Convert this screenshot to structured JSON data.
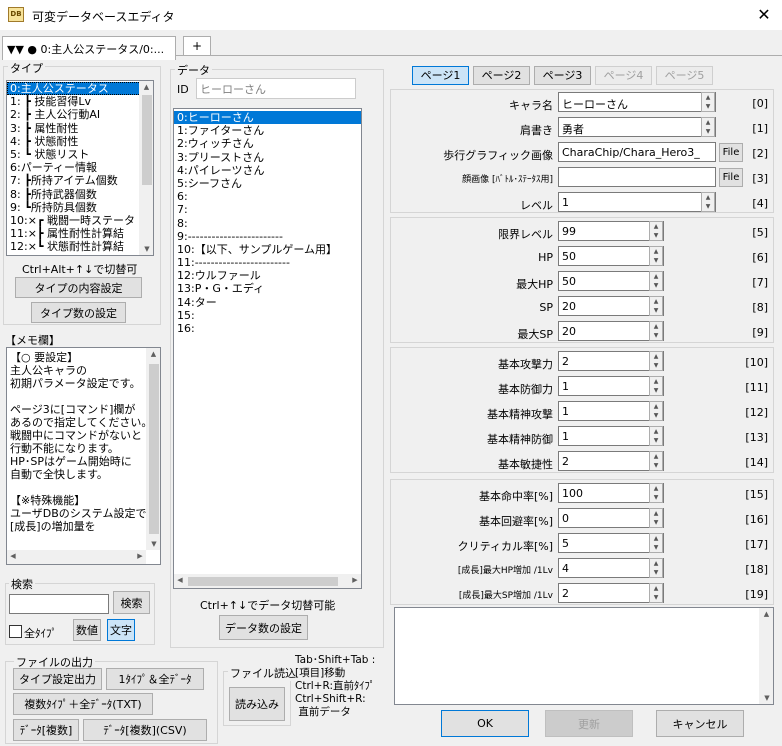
{
  "window": {
    "title": "可変データベースエディタ",
    "close": "✕",
    "app_icon": "DB"
  },
  "tabs": {
    "active": "▼▼ ● 0:主人公ステータス/0:...",
    "add": "+"
  },
  "type_panel": {
    "label": "タイプ",
    "items": [
      "0:主人公ステータス",
      "1: ┣ 技能習得Lv",
      "2: ┣ 主人公行動AI",
      "3: ┣ 属性耐性",
      "4: ┣ 状態耐性",
      "5: ┗ 状態リスト",
      "6:パーティー情報",
      "7: ┣所持アイテム個数",
      "8: ┣所持武器個数",
      "9: ┗所持防具個数",
      "10:×┏ 戦闘一時ステータ",
      "11:×┣ 属性耐性計算結",
      "12:×┗ 状態耐性計算結"
    ],
    "hint": "Ctrl+Alt+↑↓で切替可",
    "content_btn": "タイプの内容設定",
    "count_btn": "タイプ数の設定"
  },
  "memo": {
    "label": "【メモ欄】",
    "text": "【○ 要設定】\n主人公キャラの\n初期パラメータ設定です。\n\nページ3に[コマンド]欄が\nあるので指定してください。\n戦闘中にコマンドがないと\n行動不能になります。\nHP･SPはゲーム開始時に\n自動で全快します。\n\n【※特殊機能】\nユーザDBのシステム設定で\n[成長]の増加量を"
  },
  "search": {
    "label": "検索",
    "button": "検索",
    "all_types": "全ﾀｲﾌﾟ",
    "num_btn": "数値",
    "text_btn": "文字"
  },
  "file_out": {
    "label": "ファイルの出力",
    "type_out": "タイプ設定出力",
    "one_all": "1ﾀｲﾌﾟ＆全ﾃﾞｰﾀ",
    "multi_all": "複数ﾀｲﾌﾟ＋全ﾃﾞｰﾀ(TXT)",
    "data_multi": "ﾃﾞｰﾀ[複数]",
    "data_multi_csv": "ﾃﾞｰﾀ[複数](CSV)"
  },
  "file_in": {
    "label": "ファイル読込",
    "load": "読み込み"
  },
  "shortcut_help": "Tab･Shift+Tab :\n[項目]移動\nCtrl+R:直前ﾀｲﾌﾟ\nCtrl+Shift+R:\n 直前データ",
  "data_panel": {
    "label": "データ",
    "id_label": "ID",
    "id_value": "ヒーローさん",
    "items": [
      "0:ヒーローさん",
      "1:ファイターさん",
      "2:ウィッチさん",
      "3:プリーストさん",
      "4:パイレーツさん",
      "5:シーフさん",
      "6:",
      "7:",
      "8:",
      "9:------------------------",
      "10:【以下、サンプルゲーム用】",
      "11:------------------------",
      "12:ウルファール",
      "13:P・G・エディ",
      "14:ター",
      "15:",
      "16:"
    ],
    "hint": "Ctrl+↑↓でデータ切替可能",
    "count_btn": "データ数の設定"
  },
  "pages": [
    "ページ1",
    "ページ2",
    "ページ3",
    "ページ4",
    "ページ5"
  ],
  "fields_a": [
    {
      "label": "キャラ名",
      "value": "ヒーローさん",
      "idx": "[0]"
    },
    {
      "label": "肩書き",
      "value": "勇者",
      "idx": "[1]"
    },
    {
      "label": "歩行グラフィック画像",
      "value": "CharaChip/Chara_Hero3_",
      "idx": "[2]",
      "file": "File"
    },
    {
      "label": "顔画像 [ﾊﾞﾄﾙ･ｽﾃｰﾀｽ用]",
      "value": "",
      "idx": "[3]",
      "file": "File"
    },
    {
      "label": "レベル",
      "value": "1",
      "idx": "[4]"
    }
  ],
  "fields_b": [
    {
      "label": "限界レベル",
      "value": "99",
      "idx": "[5]"
    },
    {
      "label": "HP",
      "value": "50",
      "idx": "[6]"
    },
    {
      "label": "最大HP",
      "value": "50",
      "idx": "[7]"
    },
    {
      "label": "SP",
      "value": "20",
      "idx": "[8]"
    },
    {
      "label": "最大SP",
      "value": "20",
      "idx": "[9]"
    }
  ],
  "fields_c": [
    {
      "label": "基本攻撃力",
      "value": "2",
      "idx": "[10]"
    },
    {
      "label": "基本防御力",
      "value": "1",
      "idx": "[11]"
    },
    {
      "label": "基本精神攻撃",
      "value": "1",
      "idx": "[12]"
    },
    {
      "label": "基本精神防御",
      "value": "1",
      "idx": "[13]"
    },
    {
      "label": "基本敏捷性",
      "value": "2",
      "idx": "[14]"
    }
  ],
  "fields_d": [
    {
      "label": "基本命中率[%]",
      "value": "100",
      "idx": "[15]"
    },
    {
      "label": "基本回避率[%]",
      "value": "0",
      "idx": "[16]"
    },
    {
      "label": "クリティカル率[%]",
      "value": "5",
      "idx": "[17]"
    },
    {
      "label": "[成長]最大HP増加 /1Lv",
      "value": "4",
      "idx": "[18]"
    },
    {
      "label": "[成長]最大SP増加 /1Lv",
      "value": "2",
      "idx": "[19]"
    }
  ],
  "actions": {
    "ok": "OK",
    "update": "更新",
    "cancel": "キャンセル"
  }
}
